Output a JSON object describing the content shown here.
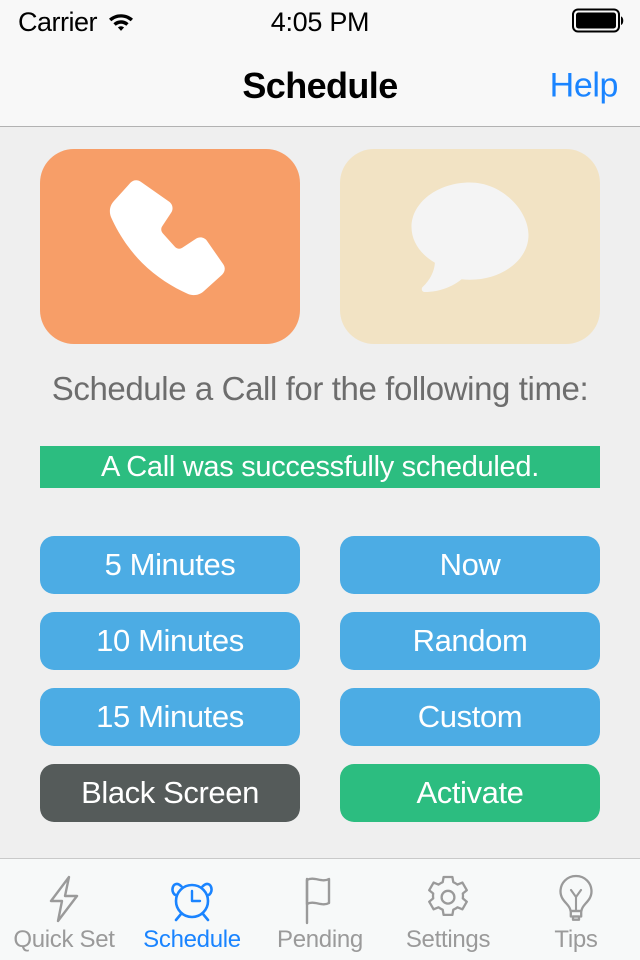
{
  "status_bar": {
    "carrier": "Carrier",
    "wifi_icon": "wifi-icon",
    "time": "4:05 PM",
    "battery_icon": "battery-full-icon"
  },
  "nav_bar": {
    "title": "Schedule",
    "right_action": "Help"
  },
  "tiles": [
    {
      "name": "call-tile",
      "icon": "phone-handset-icon",
      "bg": "#f79e68"
    },
    {
      "name": "message-tile",
      "icon": "speech-bubble-icon",
      "bg": "#f2e3c4"
    }
  ],
  "headline": "Schedule a Call for the following time:",
  "status_message": {
    "text": "A Call was successfully scheduled.",
    "color": "#2cbd80"
  },
  "buttons": [
    {
      "label": "5 Minutes",
      "style": "btn-blue",
      "name": "schedule-5-minutes-button"
    },
    {
      "label": "Now",
      "style": "btn-blue",
      "name": "schedule-now-button"
    },
    {
      "label": "10 Minutes",
      "style": "btn-blue",
      "name": "schedule-10-minutes-button"
    },
    {
      "label": "Random",
      "style": "btn-blue",
      "name": "schedule-random-button"
    },
    {
      "label": "15 Minutes",
      "style": "btn-blue",
      "name": "schedule-15-minutes-button"
    },
    {
      "label": "Custom",
      "style": "btn-blue",
      "name": "schedule-custom-button"
    },
    {
      "label": "Black Screen",
      "style": "btn-dark",
      "name": "black-screen-button"
    },
    {
      "label": "Activate",
      "style": "btn-green",
      "name": "activate-button"
    }
  ],
  "tab_bar": {
    "active_index": 1,
    "active_color": "#1a84ff",
    "inactive_color": "#9a9a9a",
    "items": [
      {
        "label": "Quick Set",
        "icon": "lightning-bolt-icon",
        "name": "tab-quick-set"
      },
      {
        "label": "Schedule",
        "icon": "alarm-clock-icon",
        "name": "tab-schedule"
      },
      {
        "label": "Pending",
        "icon": "flag-icon",
        "name": "tab-pending"
      },
      {
        "label": "Settings",
        "icon": "gear-icon",
        "name": "tab-settings"
      },
      {
        "label": "Tips",
        "icon": "lightbulb-icon",
        "name": "tab-tips"
      }
    ]
  }
}
